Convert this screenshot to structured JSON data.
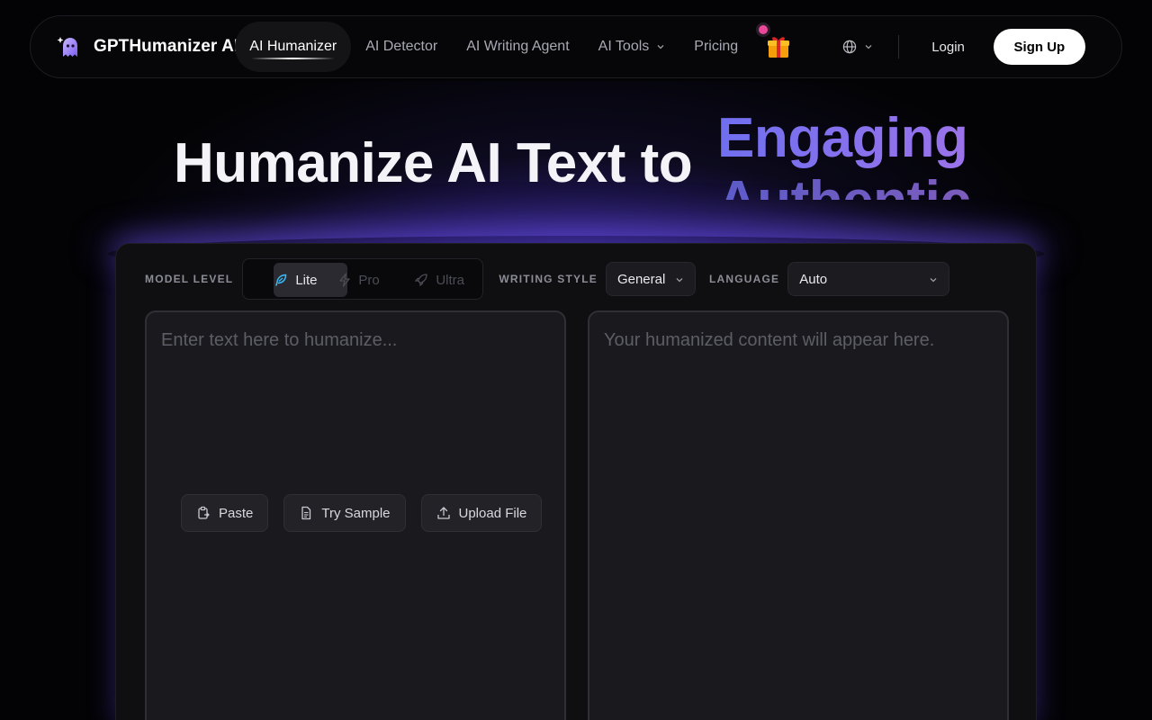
{
  "brand": {
    "name": "GPTHumanizer AI"
  },
  "nav": {
    "links": [
      {
        "label": "AI Humanizer",
        "active": true
      },
      {
        "label": "AI Detector"
      },
      {
        "label": "AI Writing Agent"
      },
      {
        "label": "AI Tools",
        "dropdown": true
      },
      {
        "label": "Pricing"
      }
    ],
    "login": "Login",
    "signup": "Sign Up"
  },
  "hero": {
    "title": "Humanize AI Text to",
    "rotating_words": [
      "Engaging",
      "Authentic"
    ]
  },
  "controls": {
    "model_label": "MODEL LEVEL",
    "models": [
      "Lite",
      "Pro",
      "Ultra"
    ],
    "selected_model": "Lite",
    "style_label": "WRITING STYLE",
    "style_value": "General",
    "language_label": "LANGUAGE",
    "language_value": "Auto"
  },
  "input": {
    "placeholder": "Enter text here to humanize...",
    "actions": [
      "Paste",
      "Try Sample",
      "Upload File"
    ]
  },
  "output": {
    "placeholder": "Your humanized content will appear here."
  },
  "colors": {
    "accent_start": "#6f6ff0",
    "accent_end": "#9b73ea",
    "notification_dot": "#ec4899",
    "background": "#030305"
  }
}
